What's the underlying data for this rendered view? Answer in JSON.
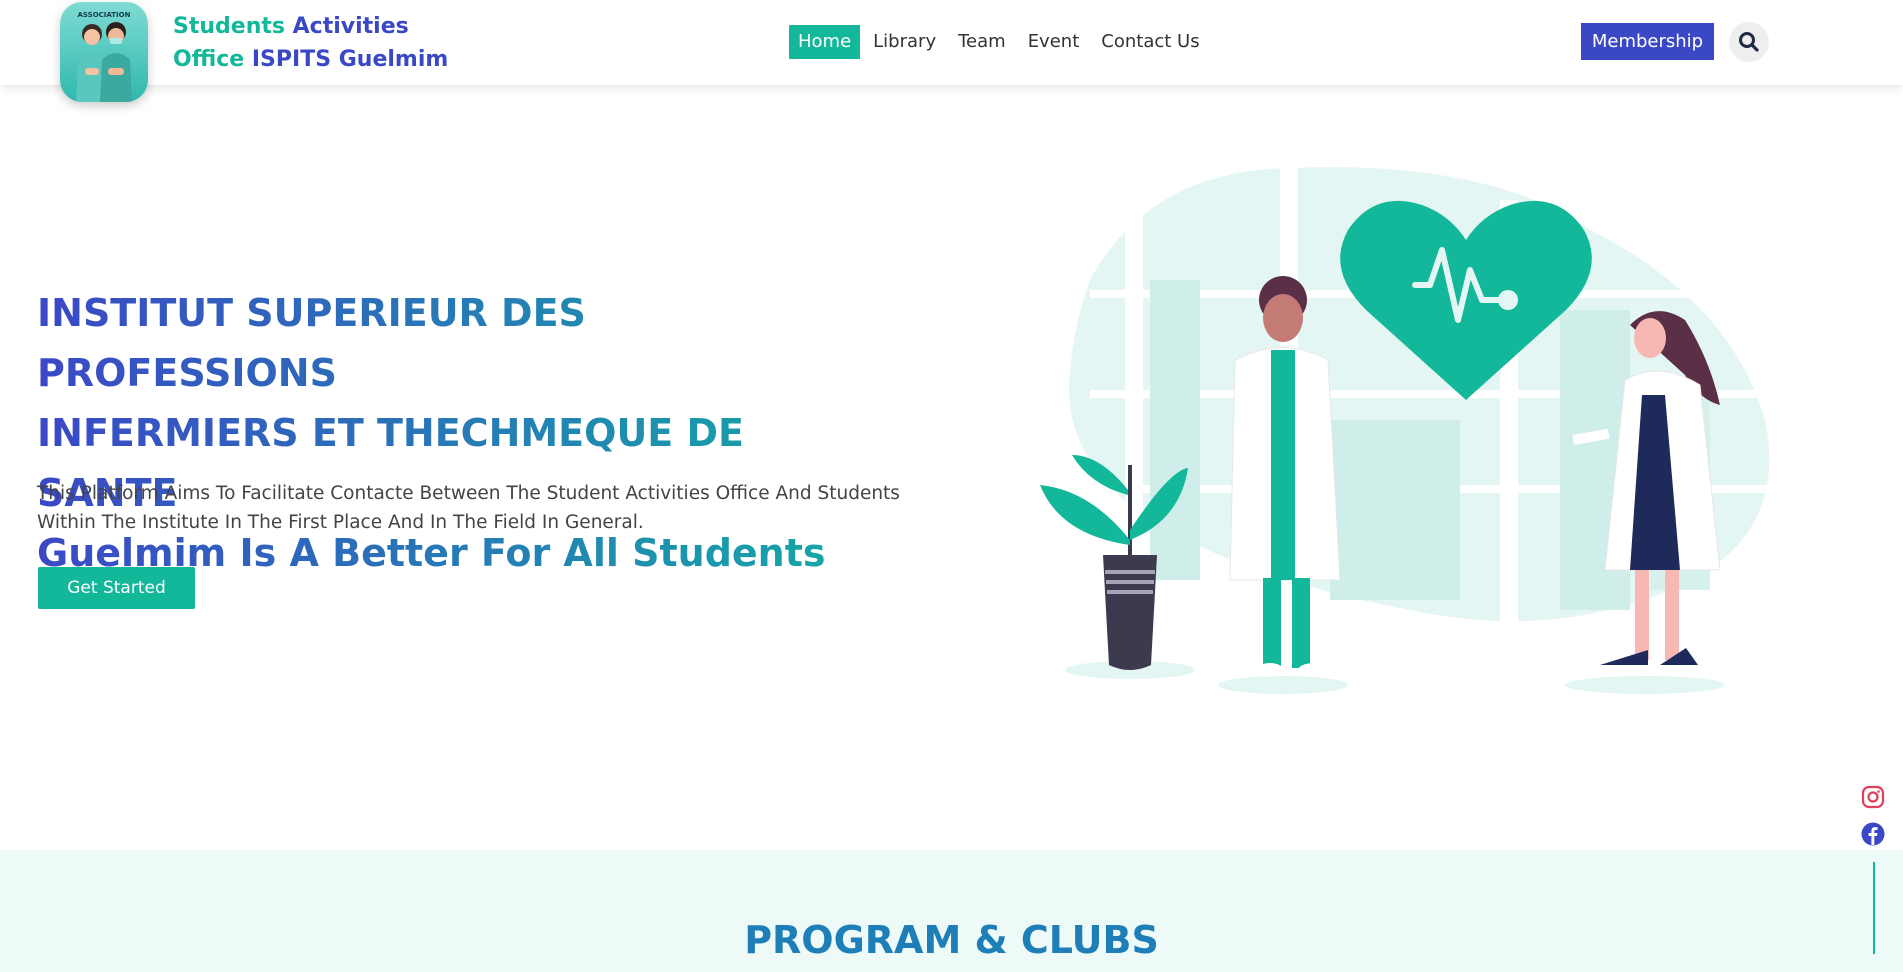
{
  "brand": {
    "line1_green": "Students",
    "line1_blue": "Activities",
    "line2_green": "Office",
    "line2_blue": "ISPITS Guelmim",
    "logo_text": "ASSOCIATION"
  },
  "nav": {
    "items": [
      {
        "label": "Home",
        "active": true
      },
      {
        "label": "Library"
      },
      {
        "label": "Team"
      },
      {
        "label": "Event"
      },
      {
        "label": "Contact Us"
      }
    ]
  },
  "header": {
    "membership_label": "Membership",
    "search_icon": "search-icon"
  },
  "hero": {
    "title_line1": "INSTITUT SUPERIEUR DES PROFESSIONS",
    "title_line2": "INFERMIERS ET THECHMEQUE DE SANTE",
    "title_line3": "Guelmim Is A Better For All Students",
    "description": "This Platform Aims To Facilitate Contacte Between The Student Activities Office And Students Within The Institute In The First Place And In The Field In General.",
    "cta_label": "Get Started"
  },
  "social": {
    "icons": [
      "instagram-icon",
      "facebook-icon"
    ]
  },
  "section": {
    "title": "PROGRAM & CLUBS"
  },
  "colors": {
    "green": "#13b79a",
    "blue": "#3b48c6",
    "section_bg": "#eefaf8"
  }
}
